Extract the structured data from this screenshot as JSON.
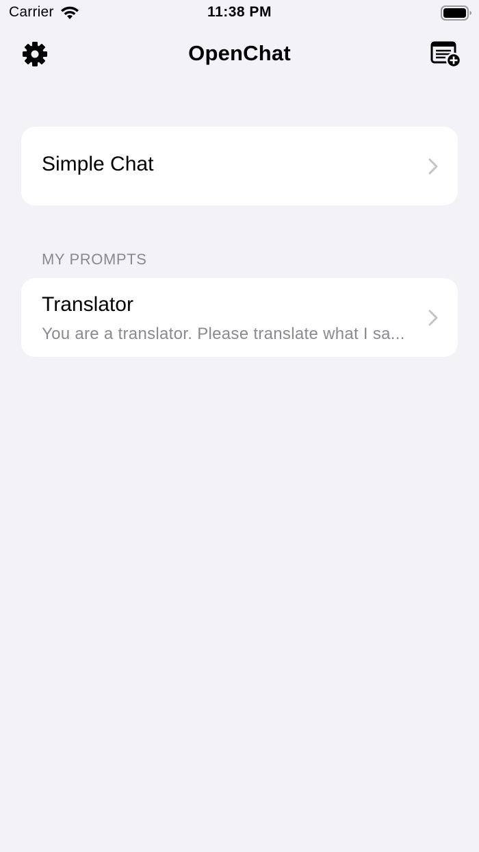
{
  "status_bar": {
    "carrier": "Carrier",
    "time": "11:38 PM",
    "wifi_icon": "wifi-icon",
    "battery_icon": "battery-icon"
  },
  "nav": {
    "title": "OpenChat",
    "settings_icon": "gear-icon",
    "new_chat_icon": "new-prompt-icon"
  },
  "simple_chat": {
    "label": "Simple Chat"
  },
  "my_prompts": {
    "header": "MY PROMPTS",
    "items": [
      {
        "title": "Translator",
        "subtitle": "You are a translator. Please translate what I sa..."
      }
    ]
  },
  "colors": {
    "background": "#f2f2f7",
    "card": "#ffffff",
    "secondary_text": "#8a8a8e",
    "chevron": "#c4c4c7"
  }
}
